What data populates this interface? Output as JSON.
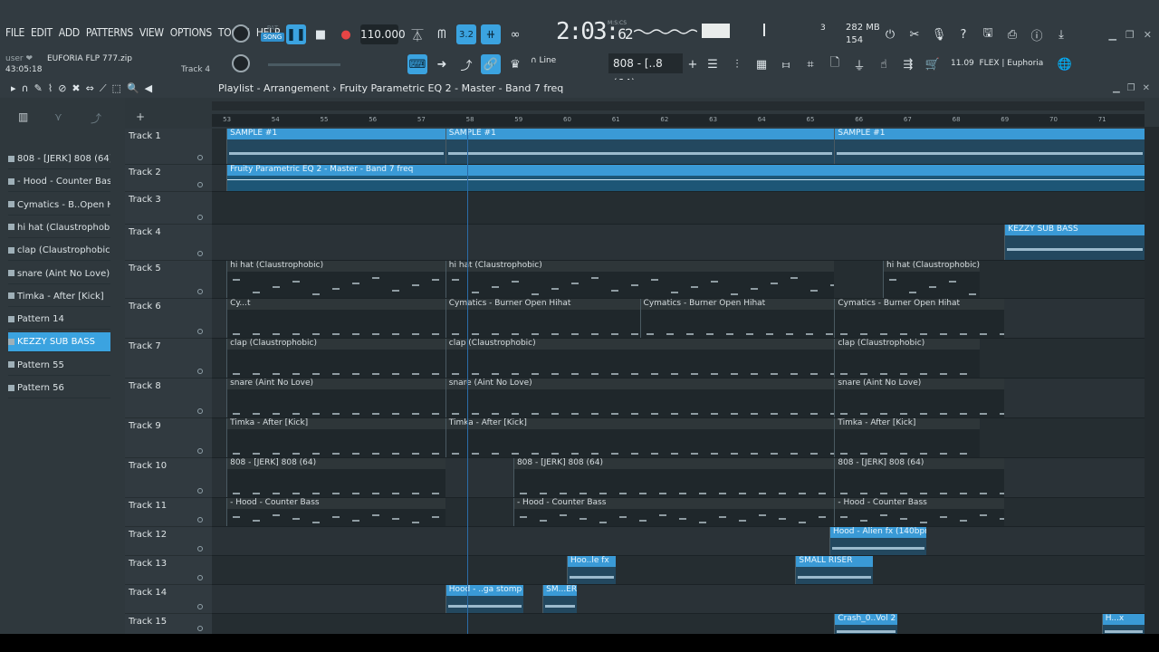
{
  "menu": [
    "FILE",
    "EDIT",
    "ADD",
    "PATTERNS",
    "VIEW",
    "OPTIONS",
    "TOOLS",
    "HELP"
  ],
  "user": "user ❤",
  "project_file": "EUFORIA FLP 777.zip",
  "time_elapsed": "43:05:18",
  "hint_track": "Track 4",
  "transport": {
    "pat": "PAT",
    "song": "SONG",
    "tempo": "110.000"
  },
  "clock": {
    "main": "2:03",
    "sub": "62",
    "label": "M:S:CS"
  },
  "stats": {
    "memory": "282 MB",
    "voices": "154",
    "poly": "3"
  },
  "toolbar": {
    "snap": "Line",
    "pattern": "808 - [..8 (64)",
    "hint_ver": "11.09",
    "hint_text": "FLEX | Euphoria"
  },
  "playlist": {
    "title": "Playlist - Arrangement",
    "title_extra": "Fruity Parametric EQ 2 - Master - Band 7 freq",
    "ruler": [
      "53",
      "54",
      "55",
      "56",
      "57",
      "58",
      "59",
      "60",
      "61",
      "62",
      "63",
      "64",
      "65",
      "66",
      "67",
      "68",
      "69",
      "70",
      "71"
    ]
  },
  "patterns": [
    {
      "name": "808 - [JERK] 808 (64)",
      "selected": false
    },
    {
      "name": "- Hood - Counter Bass",
      "selected": false
    },
    {
      "name": "Cymatics - B..Open Hihat",
      "selected": false
    },
    {
      "name": "hi hat (Claustrophobic)",
      "selected": false
    },
    {
      "name": "clap (Claustrophobic)",
      "selected": false
    },
    {
      "name": "snare (Aint No Love)",
      "selected": false
    },
    {
      "name": "Timka - After [Kick]",
      "selected": false
    },
    {
      "name": "Pattern 14",
      "selected": false
    },
    {
      "name": "KEZZY SUB BASS",
      "selected": true
    },
    {
      "name": "Pattern 55",
      "selected": false
    },
    {
      "name": "Pattern 56",
      "selected": false
    }
  ],
  "tracks": [
    {
      "name": "Track 1",
      "clips": [
        {
          "label": "SAMPLE #1",
          "kind": "audio",
          "start": 53,
          "end": 57.5
        },
        {
          "label": "SAMPLE #1",
          "kind": "audio",
          "start": 57.5,
          "end": 65.5
        },
        {
          "label": "SAMPLE #1",
          "kind": "audio",
          "start": 65.5,
          "end": 72
        }
      ]
    },
    {
      "name": "Track 2",
      "clips": [
        {
          "label": "Fruity Parametric EQ 2 - Master - Band 7 freq",
          "kind": "auto",
          "start": 53,
          "end": 72
        }
      ]
    },
    {
      "name": "Track 3",
      "clips": []
    },
    {
      "name": "Track 4",
      "clips": [
        {
          "label": "KEZZY SUB BASS",
          "kind": "audio",
          "start": 69,
          "end": 72
        }
      ]
    },
    {
      "name": "Track 5",
      "clips": [
        {
          "label": "hi hat (Claustrophobic)",
          "kind": "pattern",
          "start": 53,
          "end": 57.5
        },
        {
          "label": "hi hat (Claustrophobic)",
          "kind": "pattern",
          "start": 57.5,
          "end": 65.5
        },
        {
          "label": "hi hat (Claustrophobic)",
          "kind": "pattern",
          "start": 66.5,
          "end": 68.5
        }
      ]
    },
    {
      "name": "Track 6",
      "clips": [
        {
          "label": "Cy...t",
          "kind": "pattern",
          "start": 53,
          "end": 57.5
        },
        {
          "label": "Cymatics - Burner Open Hihat",
          "kind": "pattern",
          "start": 57.5,
          "end": 61.5
        },
        {
          "label": "Cymatics - Burner Open Hihat",
          "kind": "pattern",
          "start": 61.5,
          "end": 65.5
        },
        {
          "label": "Cymatics - Burner Open Hihat",
          "kind": "pattern",
          "start": 65.5,
          "end": 69
        }
      ]
    },
    {
      "name": "Track 7",
      "clips": [
        {
          "label": "clap (Claustrophobic)",
          "kind": "pattern",
          "start": 53,
          "end": 57.5
        },
        {
          "label": "clap (Claustrophobic)",
          "kind": "pattern",
          "start": 57.5,
          "end": 65.5
        },
        {
          "label": "clap (Claustrophobic)",
          "kind": "pattern",
          "start": 65.5,
          "end": 68.5
        }
      ]
    },
    {
      "name": "Track 8",
      "clips": [
        {
          "label": "snare (Aint No Love)",
          "kind": "pattern",
          "start": 53,
          "end": 57.5
        },
        {
          "label": "snare (Aint No Love)",
          "kind": "pattern",
          "start": 57.5,
          "end": 65.5
        },
        {
          "label": "snare (Aint No Love)",
          "kind": "pattern",
          "start": 65.5,
          "end": 69
        }
      ]
    },
    {
      "name": "Track 9",
      "clips": [
        {
          "label": "Timka - After [Kick]",
          "kind": "pattern",
          "start": 53,
          "end": 57.5
        },
        {
          "label": "Timka - After [Kick]",
          "kind": "pattern",
          "start": 57.5,
          "end": 65.5
        },
        {
          "label": "Timka - After [Kick]",
          "kind": "pattern",
          "start": 65.5,
          "end": 68.5
        }
      ]
    },
    {
      "name": "Track 10",
      "clips": [
        {
          "label": "808 - [JERK] 808 (64)",
          "kind": "pattern",
          "start": 53,
          "end": 57.5
        },
        {
          "label": "808 - [JERK] 808 (64)",
          "kind": "pattern",
          "start": 58.9,
          "end": 65.5
        },
        {
          "label": "808 - [JERK] 808 (64)",
          "kind": "pattern",
          "start": 65.5,
          "end": 69
        }
      ]
    },
    {
      "name": "Track 11",
      "clips": [
        {
          "label": "- Hood - Counter Bass",
          "kind": "pattern",
          "start": 53,
          "end": 57.5
        },
        {
          "label": "- Hood - Counter Bass",
          "kind": "pattern",
          "start": 58.9,
          "end": 65.5
        },
        {
          "label": "- Hood - Counter Bass",
          "kind": "pattern",
          "start": 65.5,
          "end": 69
        }
      ]
    },
    {
      "name": "Track 12",
      "clips": [
        {
          "label": "Hood - Alien fx (140bpm)",
          "kind": "audio",
          "start": 65.4,
          "end": 67.4
        }
      ]
    },
    {
      "name": "Track 13",
      "clips": [
        {
          "label": "Hoo..le fx",
          "kind": "audio",
          "start": 60,
          "end": 61
        },
        {
          "label": "SMALL RISER",
          "kind": "audio",
          "start": 64.7,
          "end": 66.3
        }
      ]
    },
    {
      "name": "Track 14",
      "clips": [
        {
          "label": "Hood - ..ga stomp",
          "kind": "audio",
          "start": 57.5,
          "end": 59.1
        },
        {
          "label": "SM...ER",
          "kind": "audio",
          "start": 59.5,
          "end": 60.2
        }
      ]
    },
    {
      "name": "Track 15",
      "clips": [
        {
          "label": "Crash_0..Vol 2",
          "kind": "audio",
          "start": 65.5,
          "end": 66.8
        },
        {
          "label": "H...x",
          "kind": "audio",
          "start": 71,
          "end": 72
        }
      ]
    }
  ]
}
